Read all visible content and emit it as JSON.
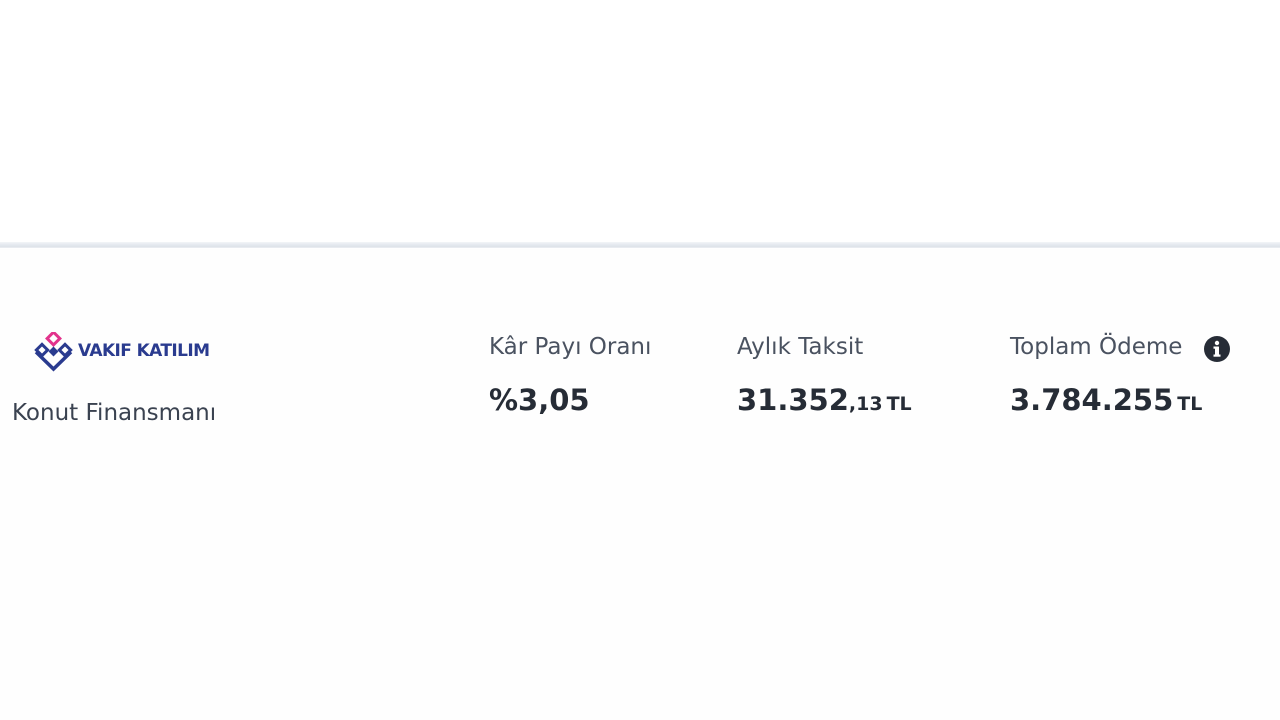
{
  "offer": {
    "bank_name": "VAKIF KATILIM",
    "product": "Konut Finansmanı",
    "profit_rate": {
      "label": "Kâr Payı Oranı",
      "value": "%3,05"
    },
    "monthly_installment": {
      "label": "Aylık Taksit",
      "integer": "31.352",
      "decimal": ",13",
      "unit": "TL"
    },
    "total_payment": {
      "label": "Toplam Ödeme",
      "value": "3.784.255",
      "unit": "TL",
      "info_icon": "info-icon"
    }
  },
  "colors": {
    "brand_blue": "#2a3b8f",
    "brand_pink": "#e2338c",
    "text_dark": "#262c36",
    "text_label": "#4a5260"
  }
}
